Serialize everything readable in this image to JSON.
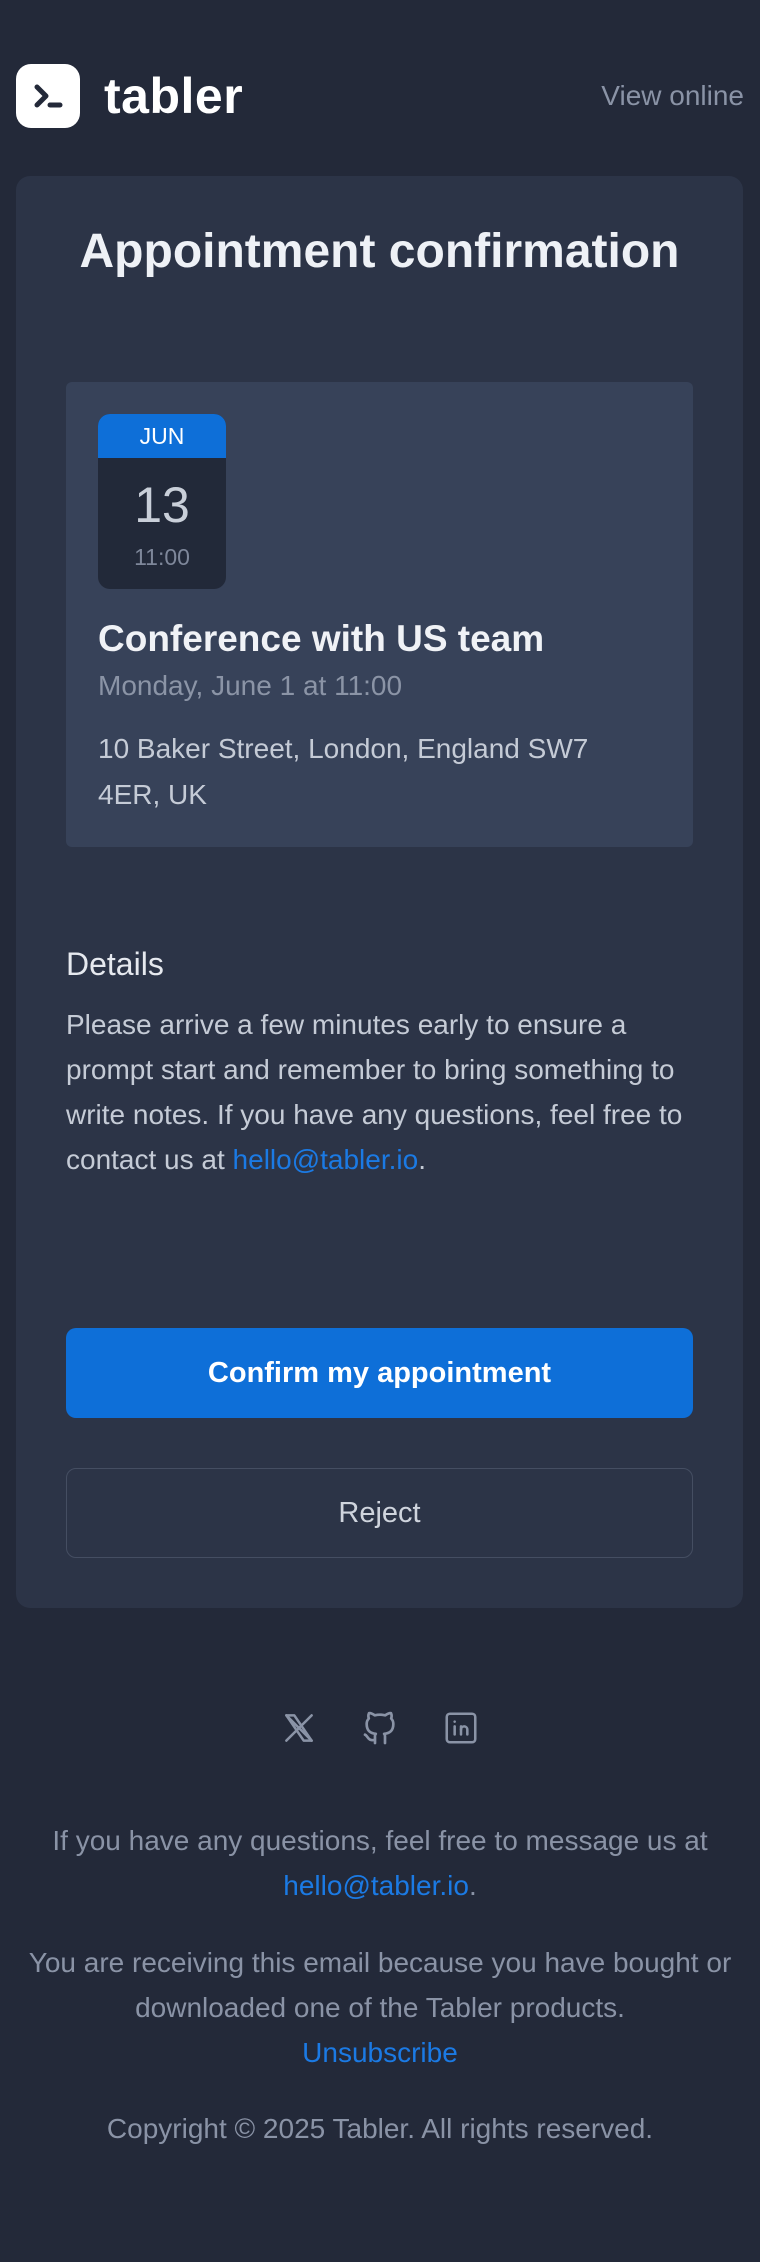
{
  "header": {
    "brand_name": "tabler",
    "logo_icon": "tabler-logo-icon",
    "view_online_label": "View online"
  },
  "card": {
    "title": "Appointment confirmation",
    "event": {
      "calendar": {
        "month": "JUN",
        "day": "13",
        "time": "11:00"
      },
      "name": "Conference with US team",
      "date_line": "Monday, June 1 at 11:00",
      "address": "10 Baker Street, London, England SW7 4ER, UK"
    },
    "details": {
      "heading": "Details",
      "text": "Please arrive a few minutes early to ensure a prompt start and remember to bring something to write notes. If you have any questions, feel free to contact us at",
      "email": "hello@tabler.io",
      "trailing": "."
    },
    "buttons": {
      "confirm_label": "Confirm my appointment",
      "reject_label": "Reject"
    }
  },
  "social": [
    {
      "icon": "x-icon"
    },
    {
      "icon": "github-icon"
    },
    {
      "icon": "linkedin-icon"
    }
  ],
  "footer": {
    "questions_text": "If you have any questions, feel free to message us at",
    "questions_email": "hello@tabler.io",
    "questions_trailing": ".",
    "receiving_text": "You are receiving this email because you have bought or downloaded one of the Tabler products.",
    "unsubscribe_label": "Unsubscribe",
    "copyright": "Copyright © 2025 Tabler. All rights reserved."
  },
  "colors": {
    "background": "#232939",
    "card": "#2c3447",
    "event_box": "#374259",
    "accent": "#0e6fd8",
    "link": "#1b7ae4"
  }
}
